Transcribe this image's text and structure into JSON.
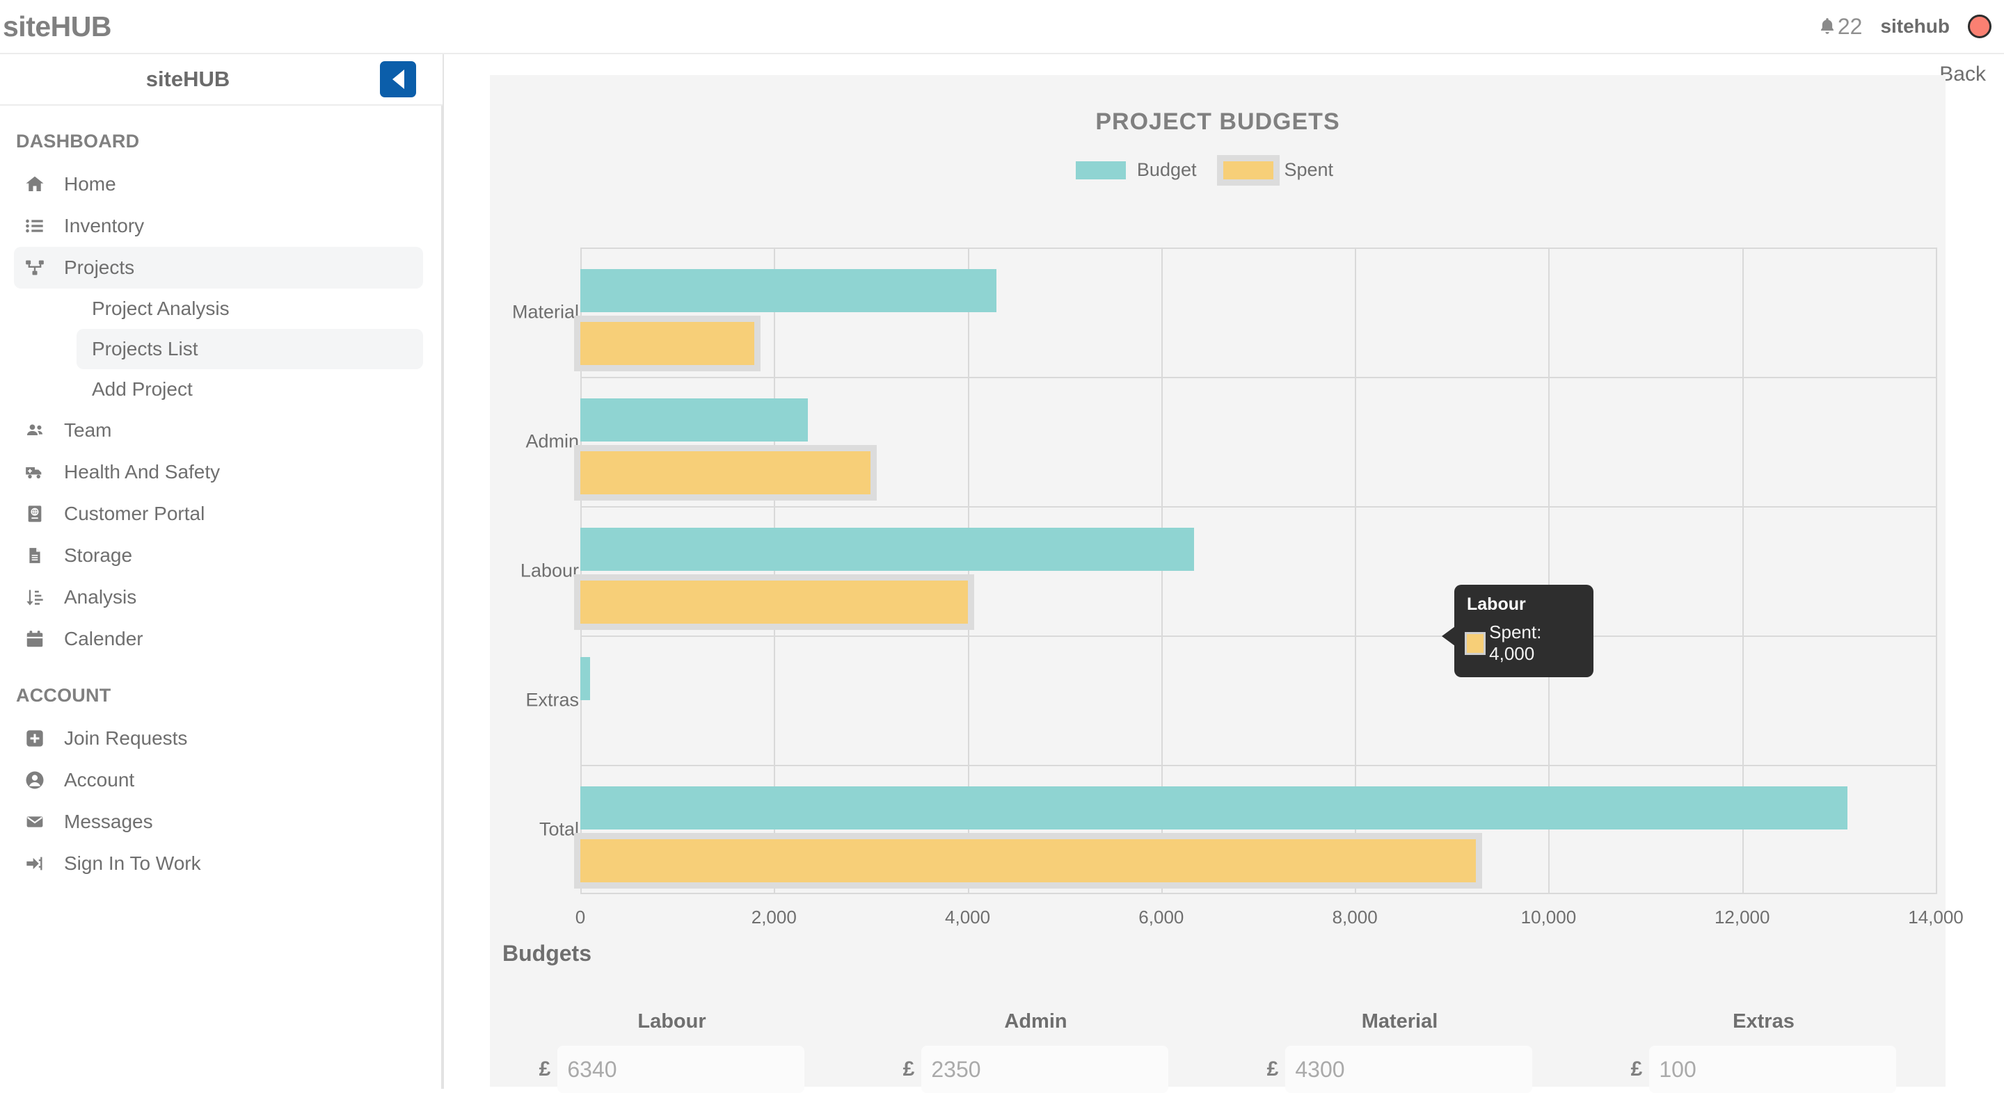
{
  "topbar": {
    "brand": "siteHUB",
    "notification_icon": "bell-icon",
    "notification_count": "22",
    "user_name": "sitehub",
    "avatar_color": "#fa8072"
  },
  "sidebar": {
    "title": "siteHUB",
    "collapse_icon": "chevron-left-icon",
    "sections": [
      {
        "label": "DASHBOARD",
        "items": [
          {
            "label": "Home",
            "icon": "home-icon",
            "active": false
          },
          {
            "label": "Inventory",
            "icon": "list-icon",
            "active": false
          },
          {
            "label": "Projects",
            "icon": "sitemap-icon",
            "active": true,
            "children": [
              {
                "label": "Project Analysis",
                "active": false
              },
              {
                "label": "Projects List",
                "active": true
              },
              {
                "label": "Add Project",
                "active": false
              }
            ]
          },
          {
            "label": "Team",
            "icon": "users-icon",
            "active": false
          },
          {
            "label": "Health And Safety",
            "icon": "ambulance-icon",
            "active": false
          },
          {
            "label": "Customer Portal",
            "icon": "portal-icon",
            "active": false
          },
          {
            "label": "Storage",
            "icon": "document-icon",
            "active": false
          },
          {
            "label": "Analysis",
            "icon": "sort-amount-icon",
            "active": false
          },
          {
            "label": "Calender",
            "icon": "calendar-icon",
            "active": false
          }
        ]
      },
      {
        "label": "ACCOUNT",
        "items": [
          {
            "label": "Join Requests",
            "icon": "plus-square-icon",
            "active": false
          },
          {
            "label": "Account",
            "icon": "user-circle-icon",
            "active": false
          },
          {
            "label": "Messages",
            "icon": "envelope-icon",
            "active": false
          },
          {
            "label": "Sign In To Work",
            "icon": "sign-in-icon",
            "active": false
          }
        ]
      }
    ]
  },
  "main": {
    "back_label": "Back",
    "budgets_heading": "Budgets",
    "budget_fields": [
      {
        "label": "Labour",
        "currency": "£",
        "placeholder": "6340"
      },
      {
        "label": "Admin",
        "currency": "£",
        "placeholder": "2350"
      },
      {
        "label": "Material",
        "currency": "£",
        "placeholder": "4300"
      },
      {
        "label": "Extras",
        "currency": "£",
        "placeholder": "100"
      }
    ]
  },
  "tooltip": {
    "title": "Labour",
    "series_label": "Spent",
    "value_text": "Spent: 4,000",
    "swatch_color": "#f7cf78"
  },
  "chart_data": {
    "type": "bar",
    "orientation": "horizontal",
    "title": "PROJECT BUDGETS",
    "categories": [
      "Material",
      "Admin",
      "Labour",
      "Extras",
      "Total"
    ],
    "series": [
      {
        "name": "Budget",
        "color": "#8fd4d2",
        "values": [
          4300,
          2350,
          6340,
          100,
          13090
        ]
      },
      {
        "name": "Spent",
        "color": "#f7cf78",
        "values": [
          1800,
          3000,
          4000,
          0,
          9250
        ]
      }
    ],
    "xlabel": "",
    "ylabel": "",
    "xlim": [
      0,
      14000
    ],
    "xticks": [
      0,
      2000,
      4000,
      6000,
      8000,
      10000,
      12000,
      14000
    ],
    "xtick_labels": [
      "0",
      "2,000",
      "4,000",
      "6,000",
      "8,000",
      "10,000",
      "12,000",
      "14,000"
    ],
    "grid": true,
    "legend_position": "top",
    "legend": [
      "Budget",
      "Spent"
    ],
    "highlighted_series": "Spent"
  }
}
